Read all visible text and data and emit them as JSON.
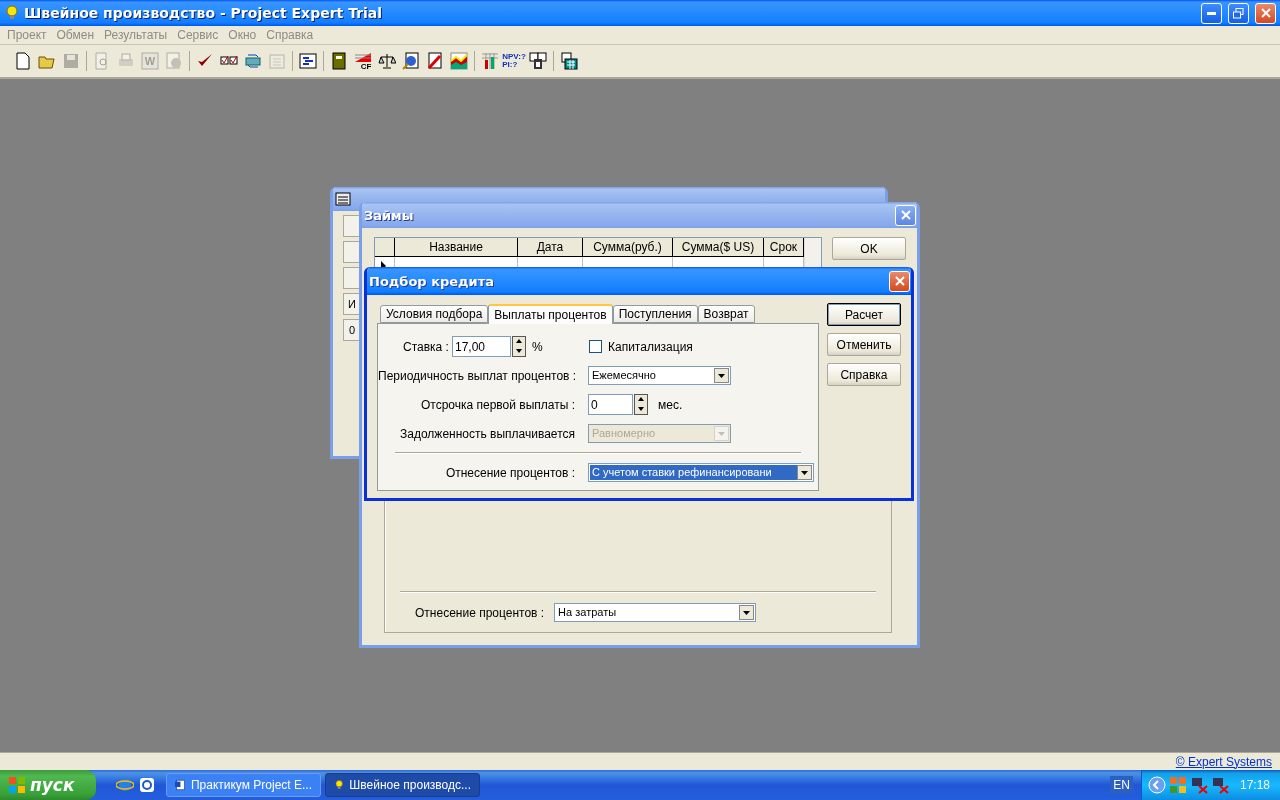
{
  "window": {
    "title": "Швейное производство - Project Expert Trial"
  },
  "menu": [
    {
      "label": "Проект",
      "disabled": true
    },
    {
      "label": "Обмен",
      "disabled": true
    },
    {
      "label": "Результаты",
      "disabled": true
    },
    {
      "label": "Сервис",
      "disabled": true
    },
    {
      "label": "Окно",
      "disabled": true
    },
    {
      "label": "Справка",
      "disabled": true
    }
  ],
  "toolbar": [
    [
      {
        "kind": "new",
        "disabled": false
      },
      {
        "kind": "open",
        "disabled": false
      },
      {
        "kind": "save",
        "disabled": true
      }
    ],
    [
      {
        "kind": "preview",
        "disabled": true
      },
      {
        "kind": "print",
        "disabled": true
      },
      {
        "kind": "word",
        "label": "W",
        "disabled": true
      },
      {
        "kind": "export",
        "disabled": true
      }
    ],
    [
      {
        "kind": "check",
        "disabled": false
      },
      {
        "kind": "compare",
        "disabled": false
      },
      {
        "kind": "refresh",
        "disabled": false
      },
      {
        "kind": "clipboard",
        "disabled": true
      }
    ],
    [
      {
        "kind": "screen",
        "disabled": false
      }
    ],
    [
      {
        "kind": "book",
        "disabled": false
      },
      {
        "kind": "cf",
        "label": "CF",
        "disabled": false
      },
      {
        "kind": "scales",
        "disabled": false
      },
      {
        "kind": "globe",
        "disabled": false
      },
      {
        "kind": "pencil",
        "disabled": false
      },
      {
        "kind": "area",
        "disabled": false
      }
    ],
    [
      {
        "kind": "bars",
        "disabled": false
      },
      {
        "kind": "npv",
        "label": "NPV:?",
        "label2": "PI:?",
        "disabled": false
      },
      {
        "kind": "windows",
        "disabled": false
      }
    ],
    [
      {
        "kind": "calc",
        "disabled": false
      }
    ]
  ],
  "back_window": {
    "texts": [
      "И",
      "0"
    ]
  },
  "loans_window": {
    "title": "Займы",
    "table": {
      "columns": [
        "Название",
        "Дата",
        "Сумма(руб.)",
        "Сумма($ US)",
        "Срок"
      ],
      "rows": [
        {
          "current": true
        }
      ]
    },
    "buttons": [
      "OK"
    ],
    "interest_allocation": {
      "label": "Отнесение процентов :",
      "value": "На затраты"
    }
  },
  "credit_dialog": {
    "title": "Подбор кредита",
    "tabs": [
      {
        "label": "Условия подбора",
        "selected": false
      },
      {
        "label": "Выплаты процентов",
        "selected": true
      },
      {
        "label": "Поступления",
        "selected": false
      },
      {
        "label": "Возврат",
        "selected": false
      }
    ],
    "rate": {
      "label": "Ставка :",
      "value": "17,00",
      "unit": "%"
    },
    "capitalization": {
      "label": "Капитализация",
      "checked": false
    },
    "payment_frequency": {
      "label": "Периодичность выплат процентов :",
      "value": "Ежемесячно",
      "disabled": false
    },
    "first_payment_delay": {
      "label": "Отсрочка первой выплаты :",
      "value": "0",
      "unit": "мес."
    },
    "debt_repayment": {
      "label": "Задолженность выплачивается",
      "value": "Равномерно",
      "disabled": true
    },
    "interest_allocation": {
      "label": "Отнесение процентов :",
      "value": "С учетом ставки рефинансировани",
      "disabled": false,
      "highlighted": true
    },
    "buttons": [
      {
        "label": "Расчет",
        "default": true
      },
      {
        "label": "Отменить",
        "default": false
      },
      {
        "label": "Справка",
        "default": false
      }
    ]
  },
  "status_bar": {
    "link": "© Expert Systems"
  },
  "taskbar": {
    "start": "пуск",
    "tasks": [
      {
        "label": "Практикум Project E...",
        "kind": "word",
        "selected": false
      },
      {
        "label": "Швейное производс...",
        "kind": "bulb",
        "selected": true
      }
    ],
    "language": "EN",
    "clock": "17:18"
  }
}
